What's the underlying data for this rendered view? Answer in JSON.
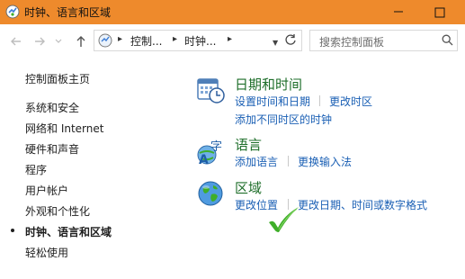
{
  "window": {
    "title": "时钟、语言和区域"
  },
  "address_bar": {
    "crumbs": [
      "控制...",
      "时钟..."
    ],
    "search_placeholder": "搜索控制面板"
  },
  "sidebar": {
    "items": [
      {
        "label": "控制面板主页"
      },
      {
        "label": "系统和安全"
      },
      {
        "label": "网络和 Internet"
      },
      {
        "label": "硬件和声音"
      },
      {
        "label": "程序"
      },
      {
        "label": "用户帐户"
      },
      {
        "label": "外观和个性化"
      },
      {
        "label": "时钟、语言和区域",
        "current": true
      },
      {
        "label": "轻松使用"
      }
    ]
  },
  "categories": {
    "datetime": {
      "title": "日期和时间",
      "links": [
        "设置时间和日期",
        "更改时区",
        "添加不同时区的时钟"
      ]
    },
    "language": {
      "title": "语言",
      "links": [
        "添加语言",
        "更换输入法"
      ]
    },
    "region": {
      "title": "区域",
      "links": [
        "更改位置",
        "更改日期、时间或数字格式"
      ]
    }
  },
  "colors": {
    "titlebar": "#ee8a2c",
    "category_title": "#1e6e2a",
    "link": "#1a5fb4",
    "checkmark": "#3fae29"
  },
  "icons": {
    "app": "control-panel-icon",
    "datetime": "calendar-clock-icon",
    "language": "language-icon",
    "region": "globe-icon",
    "annotation": "green-checkmark-icon"
  }
}
